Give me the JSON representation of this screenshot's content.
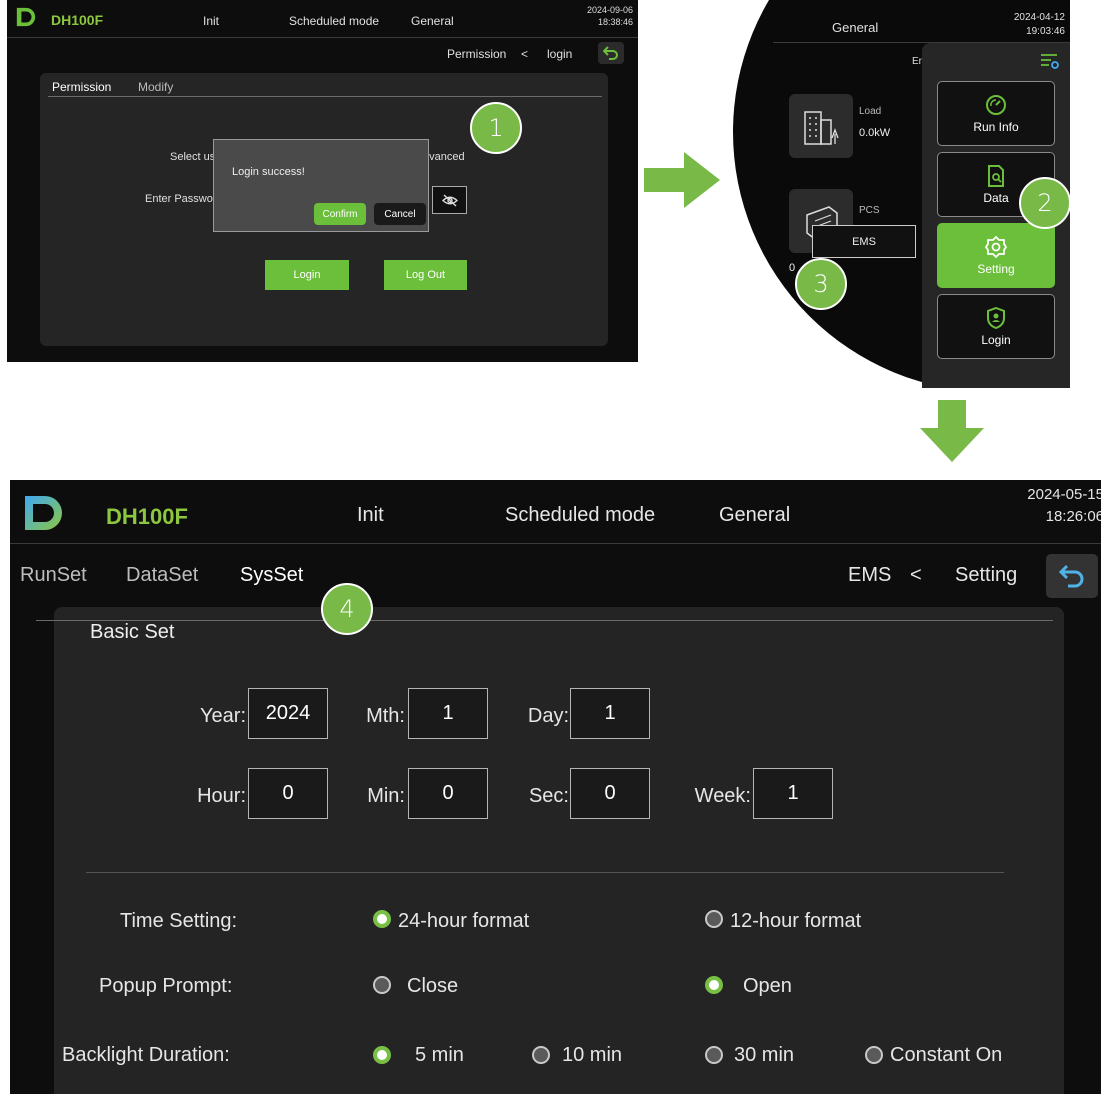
{
  "steps": [
    "1",
    "2",
    "3",
    "4"
  ],
  "colors": {
    "accent_green": "#6bbf3a",
    "brand_green": "#8dc63f",
    "step_circle": "#78b947",
    "background": "#0d0d0d"
  },
  "panel_login": {
    "brand": "DH100F",
    "menu": [
      "Init",
      "Scheduled mode",
      "General"
    ],
    "date": "2024-09-06",
    "time": "18:38:46",
    "breadcrumb": {
      "parent": "Permission",
      "separator": "<",
      "current": "login"
    },
    "tabs": [
      "Permission",
      "Modify"
    ],
    "select_label": "Select us",
    "advanced_text": "dvanced",
    "password_label": "Enter Passwo",
    "login_button": "Login",
    "logout_button": "Log Out",
    "dialog": {
      "message": "Login success!",
      "confirm": "Confirm",
      "cancel": "Cancel"
    },
    "icons": [
      "back-icon",
      "eye-off-icon"
    ]
  },
  "panel_zoom": {
    "header": "General",
    "date": "2024-04-12",
    "time": "19:03:46",
    "partial_label": "Er",
    "load_label": "Load",
    "load_value": "0.0kW",
    "pcs_label": "PCS",
    "partial_value": "0",
    "ems_button": "EMS",
    "sidebar": [
      {
        "label": "Run Info",
        "icon": "speedometer-icon",
        "active": false
      },
      {
        "label": "Data",
        "icon": "document-search-icon",
        "active": false
      },
      {
        "label": "Setting",
        "icon": "gear-icon",
        "active": true
      },
      {
        "label": "Login",
        "icon": "user-shield-icon",
        "active": false
      }
    ]
  },
  "panel_sysset": {
    "brand": "DH100F",
    "menu": [
      "Init",
      "Scheduled mode",
      "General"
    ],
    "date": "2024-05-15",
    "time": "18:26:06",
    "tabs": [
      "RunSet",
      "DataSet",
      "SysSet"
    ],
    "selected_tab": "SysSet",
    "breadcrumb": {
      "parent": "EMS",
      "separator": "<",
      "current": "Setting"
    },
    "section_title": "Basic Set",
    "fields": {
      "year": {
        "label": "Year:",
        "value": "2024"
      },
      "month": {
        "label": "Mth:",
        "value": "1"
      },
      "day": {
        "label": "Day:",
        "value": "1"
      },
      "hour": {
        "label": "Hour:",
        "value": "0"
      },
      "minute": {
        "label": "Min:",
        "value": "0"
      },
      "second": {
        "label": "Sec:",
        "value": "0"
      },
      "week": {
        "label": "Week:",
        "value": "1"
      }
    },
    "time_setting": {
      "label": "Time Setting:",
      "options": [
        "24-hour format",
        "12-hour format"
      ],
      "selected": "24-hour format"
    },
    "popup_prompt": {
      "label": "Popup Prompt:",
      "options": [
        "Close",
        "Open"
      ],
      "selected": "Open"
    },
    "backlight": {
      "label": "Backlight Duration:",
      "options": [
        "5 min",
        "10 min",
        "30 min",
        "Constant On"
      ],
      "selected": "5 min"
    }
  }
}
